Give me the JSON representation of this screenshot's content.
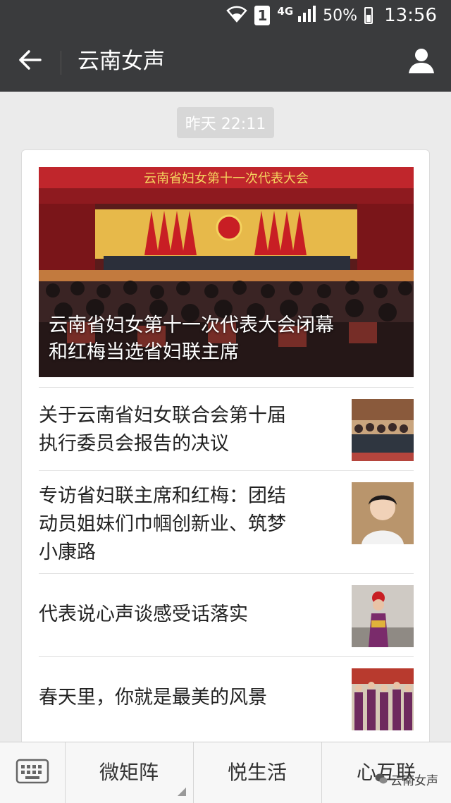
{
  "status_bar": {
    "sim": "1",
    "network": "4G",
    "battery": "50%",
    "time": "13:56"
  },
  "header": {
    "title": "云南女声"
  },
  "timestamp": "昨天 22:11",
  "hero": {
    "banner": "云南省妇女第十一次代表大会",
    "title_line1": "云南省妇女第十一次代表大会闭幕",
    "title_line2": "和红梅当选省妇联主席"
  },
  "articles": [
    {
      "line1": "关于云南省妇女联合会第十届",
      "line2": "执行委员会报告的决议",
      "line3": ""
    },
    {
      "line1": "专访省妇联主席和红梅：团结",
      "line2": "动员姐妹们巾帼创新业、筑梦",
      "line3": "小康路"
    },
    {
      "line1": "代表说心声谈感受话落实",
      "line2": "",
      "line3": ""
    },
    {
      "line1": "春天里，你就是最美的风景",
      "line2": "",
      "line3": ""
    }
  ],
  "bottom_menu": {
    "items": [
      "微矩阵",
      "悦生活",
      "心互联"
    ],
    "watermark": "云南女声"
  },
  "colors": {
    "header_bg": "#3a3b3d",
    "page_bg": "#ebebeb",
    "stage_red": "#b8202a"
  }
}
